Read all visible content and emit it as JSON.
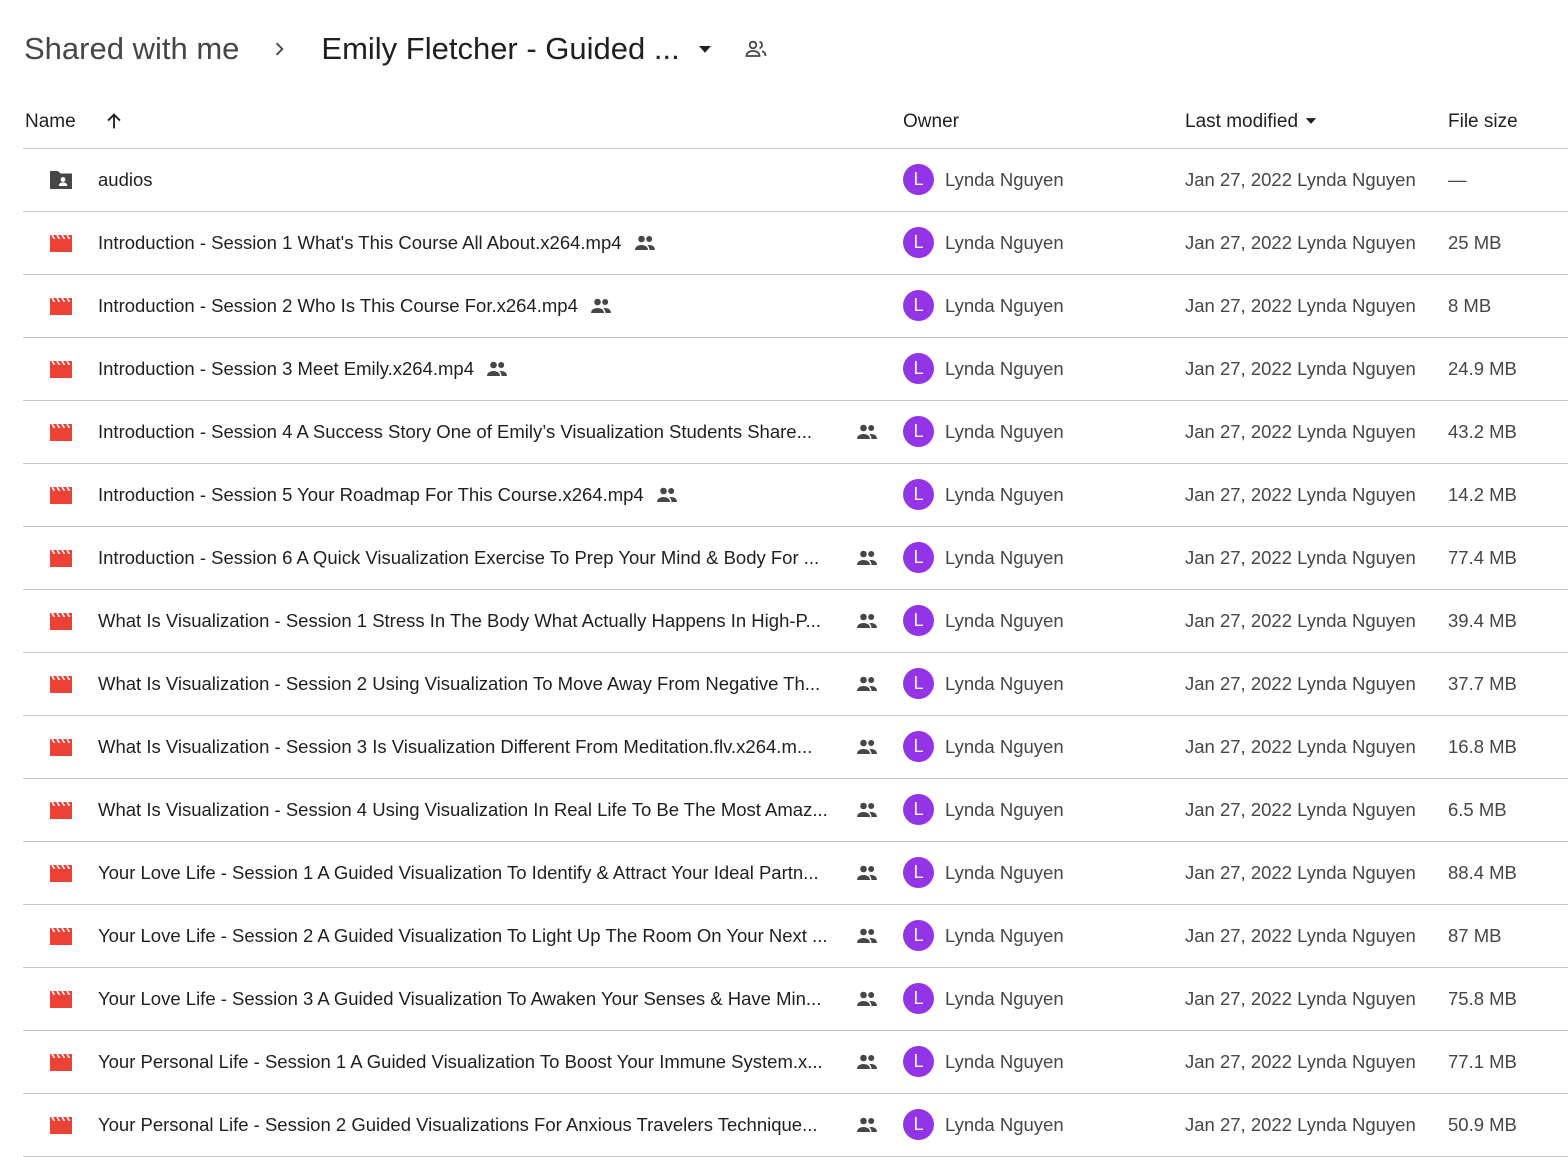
{
  "breadcrumb": {
    "root": "Shared with me",
    "current": "Emily Fletcher - Guided ..."
  },
  "columns": {
    "name": "Name",
    "owner": "Owner",
    "last_modified": "Last modified",
    "file_size": "File size"
  },
  "colors": {
    "video_icon": "#ea4335",
    "folder_icon": "#444746",
    "avatar": "#9334e6"
  },
  "rows": [
    {
      "type": "folder",
      "name": "audios",
      "shared": false,
      "owner": "Lynda Nguyen",
      "avatar": "L",
      "modified": "Jan 27, 2022 Lynda Nguyen",
      "size": "—"
    },
    {
      "type": "video",
      "name": "Introduction - Session 1 What's This Course All About.x264.mp4",
      "shared": true,
      "owner": "Lynda Nguyen",
      "avatar": "L",
      "modified": "Jan 27, 2022 Lynda Nguyen",
      "size": "25 MB"
    },
    {
      "type": "video",
      "name": "Introduction - Session 2 Who Is This Course For.x264.mp4",
      "shared": true,
      "owner": "Lynda Nguyen",
      "avatar": "L",
      "modified": "Jan 27, 2022 Lynda Nguyen",
      "size": "8 MB"
    },
    {
      "type": "video",
      "name": "Introduction - Session 3 Meet Emily.x264.mp4",
      "shared": true,
      "owner": "Lynda Nguyen",
      "avatar": "L",
      "modified": "Jan 27, 2022 Lynda Nguyen",
      "size": "24.9 MB"
    },
    {
      "type": "video",
      "name": "Introduction - Session 4 A Success Story One of Emily’s Visualization Students Share...",
      "shared": true,
      "owner": "Lynda Nguyen",
      "avatar": "L",
      "modified": "Jan 27, 2022 Lynda Nguyen",
      "size": "43.2 MB"
    },
    {
      "type": "video",
      "name": "Introduction - Session 5 Your Roadmap For This Course.x264.mp4",
      "shared": true,
      "owner": "Lynda Nguyen",
      "avatar": "L",
      "modified": "Jan 27, 2022 Lynda Nguyen",
      "size": "14.2 MB"
    },
    {
      "type": "video",
      "name": "Introduction - Session 6 A Quick Visualization Exercise To Prep Your Mind & Body For ...",
      "shared": true,
      "owner": "Lynda Nguyen",
      "avatar": "L",
      "modified": "Jan 27, 2022 Lynda Nguyen",
      "size": "77.4 MB"
    },
    {
      "type": "video",
      "name": "What Is Visualization - Session 1 Stress In The Body What Actually Happens In High-P...",
      "shared": true,
      "owner": "Lynda Nguyen",
      "avatar": "L",
      "modified": "Jan 27, 2022 Lynda Nguyen",
      "size": "39.4 MB"
    },
    {
      "type": "video",
      "name": "What Is Visualization - Session 2 Using Visualization To Move Away From Negative Th...",
      "shared": true,
      "owner": "Lynda Nguyen",
      "avatar": "L",
      "modified": "Jan 27, 2022 Lynda Nguyen",
      "size": "37.7 MB"
    },
    {
      "type": "video",
      "name": "What Is Visualization - Session 3 Is Visualization Different From Meditation.flv.x264.m...",
      "shared": true,
      "owner": "Lynda Nguyen",
      "avatar": "L",
      "modified": "Jan 27, 2022 Lynda Nguyen",
      "size": "16.8 MB"
    },
    {
      "type": "video",
      "name": "What Is Visualization - Session 4 Using Visualization In Real Life To Be The Most Amaz...",
      "shared": true,
      "owner": "Lynda Nguyen",
      "avatar": "L",
      "modified": "Jan 27, 2022 Lynda Nguyen",
      "size": "6.5 MB"
    },
    {
      "type": "video",
      "name": "Your Love Life - Session 1 A Guided Visualization To Identify & Attract Your Ideal Partn...",
      "shared": true,
      "owner": "Lynda Nguyen",
      "avatar": "L",
      "modified": "Jan 27, 2022 Lynda Nguyen",
      "size": "88.4 MB"
    },
    {
      "type": "video",
      "name": "Your Love Life - Session 2 A Guided Visualization To Light Up The Room On Your Next ...",
      "shared": true,
      "owner": "Lynda Nguyen",
      "avatar": "L",
      "modified": "Jan 27, 2022 Lynda Nguyen",
      "size": "87 MB"
    },
    {
      "type": "video",
      "name": "Your Love Life - Session 3 A Guided Visualization To Awaken Your Senses & Have Min...",
      "shared": true,
      "owner": "Lynda Nguyen",
      "avatar": "L",
      "modified": "Jan 27, 2022 Lynda Nguyen",
      "size": "75.8 MB"
    },
    {
      "type": "video",
      "name": "Your Personal Life - Session 1 A Guided Visualization To Boost Your Immune System.x...",
      "shared": true,
      "owner": "Lynda Nguyen",
      "avatar": "L",
      "modified": "Jan 27, 2022 Lynda Nguyen",
      "size": "77.1 MB"
    },
    {
      "type": "video",
      "name": "Your Personal Life - Session 2 Guided Visualizations For Anxious Travelers Technique...",
      "shared": true,
      "owner": "Lynda Nguyen",
      "avatar": "L",
      "modified": "Jan 27, 2022 Lynda Nguyen",
      "size": "50.9 MB"
    }
  ]
}
